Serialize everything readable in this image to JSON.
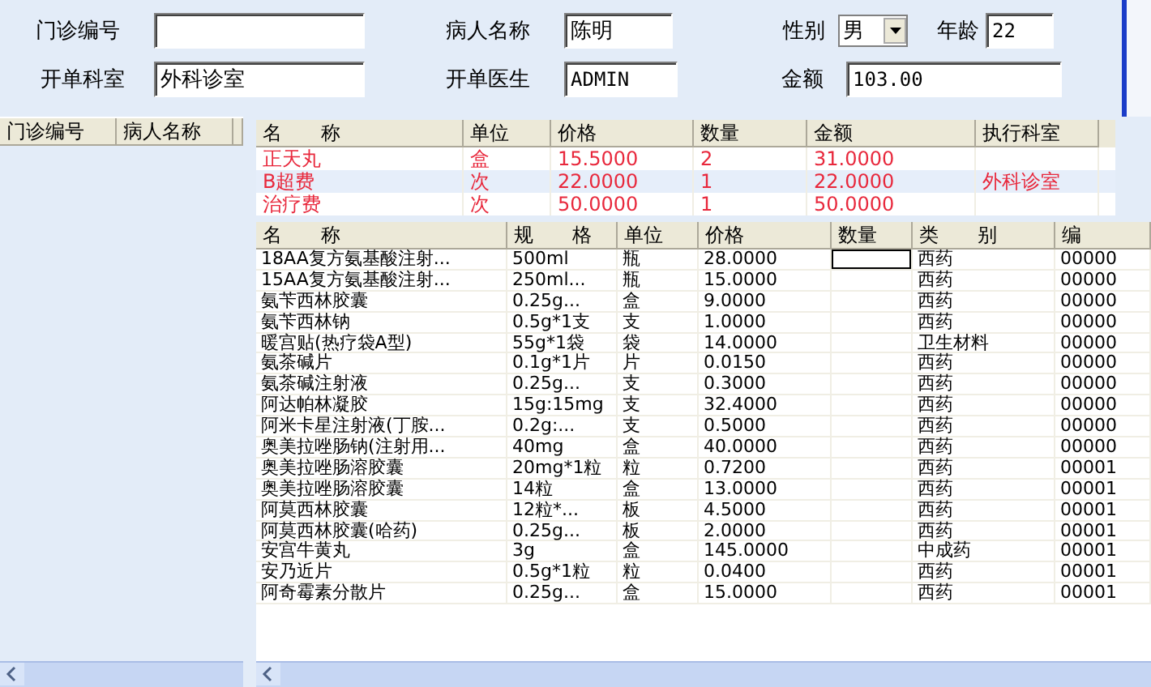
{
  "form": {
    "clinic_no": {
      "label": "门诊编号"
    },
    "patient_name": {
      "label": "病人名称",
      "value": "陈明"
    },
    "sex": {
      "label": "性别",
      "value": "男"
    },
    "age": {
      "label": "年龄",
      "value": "22"
    },
    "department": {
      "label": "开单科室",
      "value": "外科诊室"
    },
    "doctor": {
      "label": "开单医生",
      "value": "ADMIN"
    },
    "amount": {
      "label": "金额",
      "value": "103.00"
    }
  },
  "patient_list": {
    "columns": [
      "门诊编号",
      "病人名称"
    ]
  },
  "order_table": {
    "columns": [
      "名　　称",
      "单位",
      "价格",
      "数量",
      "金额",
      "执行科室"
    ],
    "rows": [
      {
        "cells": [
          "正天丸",
          "盒",
          "15.5000",
          "2",
          "31.0000",
          null
        ],
        "selected": false
      },
      {
        "cells": [
          "B超费",
          "次",
          "22.0000",
          "1",
          "22.0000",
          "外科诊室"
        ],
        "selected": true
      },
      {
        "cells": [
          "治疗费",
          "次",
          "50.0000",
          "1",
          "50.0000",
          null
        ],
        "selected": false
      }
    ]
  },
  "drug_table": {
    "columns": [
      "名　　称",
      "规　　格",
      "单位",
      "价格",
      "数量",
      "类　　别",
      "编"
    ],
    "rows": [
      {
        "cells": [
          "18AA复方氨基酸注射...",
          "500ml",
          "瓶",
          "28.0000",
          null,
          "西药",
          "00000"
        ],
        "editing": true
      },
      {
        "cells": [
          "15AA复方氨基酸注射...",
          "250ml...",
          "瓶",
          "15.0000",
          null,
          "西药",
          "00000"
        ],
        "editing": false
      },
      {
        "cells": [
          "氨苄西林胶囊",
          "0.25g...",
          "盒",
          "9.0000",
          null,
          "西药",
          "00000"
        ],
        "editing": false
      },
      {
        "cells": [
          "氨苄西林钠",
          "0.5g*1支",
          "支",
          "1.0000",
          null,
          "西药",
          "00000"
        ],
        "editing": false
      },
      {
        "cells": [
          "暖宫贴(热疗袋A型)",
          "55g*1袋",
          "袋",
          "14.0000",
          null,
          "卫生材料",
          "00000"
        ],
        "editing": false
      },
      {
        "cells": [
          "氨茶碱片",
          "0.1g*1片",
          "片",
          "0.0150",
          null,
          "西药",
          "00000"
        ],
        "editing": false
      },
      {
        "cells": [
          "氨茶碱注射液",
          "0.25g...",
          "支",
          "0.3000",
          null,
          "西药",
          "00000"
        ],
        "editing": false
      },
      {
        "cells": [
          "阿达帕林凝胶",
          "15g:15mg",
          "支",
          "32.4000",
          null,
          "西药",
          "00000"
        ],
        "editing": false
      },
      {
        "cells": [
          "阿米卡星注射液(丁胺...",
          "0.2g:...",
          "支",
          "0.5000",
          null,
          "西药",
          "00000"
        ],
        "editing": false
      },
      {
        "cells": [
          "奥美拉唑肠钠(注射用...",
          "40mg",
          "盒",
          "40.0000",
          null,
          "西药",
          "00000"
        ],
        "editing": false
      },
      {
        "cells": [
          "奥美拉唑肠溶胶囊",
          "20mg*1粒",
          "粒",
          "0.7200",
          null,
          "西药",
          "00001"
        ],
        "editing": false
      },
      {
        "cells": [
          "奥美拉唑肠溶胶囊",
          "14粒",
          "盒",
          "13.0000",
          null,
          "西药",
          "00001"
        ],
        "editing": false
      },
      {
        "cells": [
          "阿莫西林胶囊",
          "12粒*...",
          "板",
          "4.5000",
          null,
          "西药",
          "00001"
        ],
        "editing": false
      },
      {
        "cells": [
          "阿莫西林胶囊(哈药)",
          "0.25g...",
          "板",
          "2.0000",
          null,
          "西药",
          "00001"
        ],
        "editing": false
      },
      {
        "cells": [
          "安宫牛黄丸",
          "3g",
          "盒",
          "145.0000",
          null,
          "中成药",
          "00001"
        ],
        "editing": false
      },
      {
        "cells": [
          "安乃近片",
          "0.5g*1粒",
          "粒",
          "0.0400",
          null,
          "西药",
          "00001"
        ],
        "editing": false
      },
      {
        "cells": [
          "阿奇霉素分散片",
          "0.25g...",
          "盒",
          "15.0000",
          null,
          "西药",
          "00001"
        ],
        "editing": false
      }
    ]
  }
}
